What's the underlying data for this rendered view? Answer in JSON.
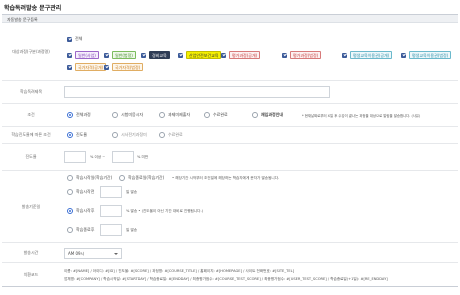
{
  "page": {
    "title": "학습독려발송 문구관리"
  },
  "section": {
    "title": "자동발송 문구등록"
  },
  "targets": {
    "label": "대상과정(구분/과정명)",
    "all_label": "전체",
    "tags": [
      {
        "text": "일반(사업)",
        "color": "purple"
      },
      {
        "text": "일반(법정)",
        "color": "green"
      },
      {
        "text": "경비교육",
        "color": "dark"
      },
      {
        "text": "산업안전보건교육",
        "color": "yellow"
      },
      {
        "text": "평가과정(공개)",
        "color": "red"
      },
      {
        "text": "평가과정(법정)",
        "color": "red"
      },
      {
        "text": "평생교육이용권(공개)",
        "color": "teal"
      },
      {
        "text": "평생교육이용권(법정)",
        "color": "teal"
      },
      {
        "text": "국가자격(공개)",
        "color": "orange"
      },
      {
        "text": "국가자격(법정)",
        "color": "orange"
      }
    ]
  },
  "template_name": {
    "label": "학습독려제목",
    "value": ""
  },
  "condition": {
    "label": "조건",
    "options": [
      "전체과정",
      "시험미응시자",
      "과제미제출자",
      "수료완료",
      "재입과정안내"
    ],
    "selected": 0,
    "note": "* 현재날짜로부터 X일 후 수강이 끝나는 과정을 대상으로 알림을 발송합니다. (사유)"
  },
  "sms_condition": {
    "label": "학습진도율에 따른 조건",
    "options": [
      "진도율",
      "시사전기과정미",
      "수료완료"
    ],
    "selected": 0
  },
  "progress": {
    "label": "진도율",
    "between_label": "% 이상 ~",
    "end_label": "% 미만",
    "value_from": "",
    "value_to": ""
  },
  "send_timing": {
    "label": "발송기준일",
    "rows": [
      {
        "radio": "학습시작일(학습기간)",
        "radio2": "학습종료일(학습기간)",
        "note": "• 해당기간 시작부터 조건일에 해당하는 학습자에게 문자가 발송됩니다.",
        "unit": "",
        "selected": false
      },
      {
        "radio": "학습시작전",
        "note": "",
        "unit": "일 발송",
        "selected": false
      },
      {
        "radio": "학습시작후",
        "note": "",
        "unit": "% 발송 • (진도율이 아닌 기간 대비로 진행됩니다.)",
        "selected": true
      },
      {
        "radio": "학습종료후",
        "note": "",
        "unit": "일 발송",
        "selected": false
      }
    ]
  },
  "send_time": {
    "label": "발송시간",
    "value": "AM 09시"
  },
  "template_code": {
    "label": "치환코드",
    "line1": "이름: #[NAME] / 아이디: #[ID] / 진도율: #[SCORE] / 과정명: #[COURSE_TITLE] / 홈페이지: #[HOMEPAGE] / 사이트 전화번호: #[SITE_TEL]",
    "line2": "업체명: #[COMPANY] / 학습시작일: #[STARTDAY] / 학습종료일: #[ENDDAY] / 최종평가점수: #[COURSE_TEST_SCORE] / 최종평가점수: #[USER_TEST_SCORE] / 학습종료일(+1일): #[RE_ENDDAY]"
  }
}
